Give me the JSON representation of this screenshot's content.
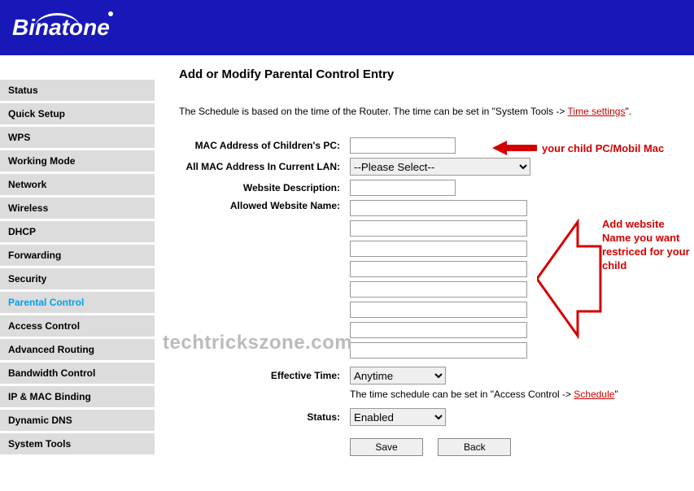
{
  "brand": "Binatone",
  "sidebar": {
    "items": [
      {
        "label": "Status"
      },
      {
        "label": "Quick Setup"
      },
      {
        "label": "WPS"
      },
      {
        "label": "Working Mode"
      },
      {
        "label": "Network"
      },
      {
        "label": "Wireless"
      },
      {
        "label": "DHCP"
      },
      {
        "label": "Forwarding"
      },
      {
        "label": "Security"
      },
      {
        "label": "Parental Control"
      },
      {
        "label": "Access Control"
      },
      {
        "label": "Advanced Routing"
      },
      {
        "label": "Bandwidth Control"
      },
      {
        "label": "IP & MAC Binding"
      },
      {
        "label": "Dynamic DNS"
      },
      {
        "label": "System Tools"
      }
    ]
  },
  "page": {
    "title": "Add or Modify Parental Control Entry",
    "scheduleText1": "The Schedule is based on the time of the Router. The time can be set in \"System Tools -> ",
    "scheduleLink": "Time settings",
    "scheduleText2": "\".",
    "labels": {
      "mac": "MAC Address of Children's PC:",
      "allMac": "All MAC Address In Current LAN:",
      "desc": "Website Description:",
      "allowed": "Allowed Website Name:",
      "time": "Effective Time:",
      "status": "Status:"
    },
    "allMacPlaceholder": "--Please Select--",
    "timeValue": "Anytime",
    "statusValue": "Enabled",
    "helpText1": "The time schedule can be set in \"Access Control -> ",
    "helpLink": "Schedule",
    "helpText2": "\"",
    "saveBtn": "Save",
    "backBtn": "Back"
  },
  "watermark": "techtrickszone.com",
  "annotations": {
    "a1": "your child PC/Mobil Mac",
    "a2": "Add website Name you want restriced for your child"
  }
}
